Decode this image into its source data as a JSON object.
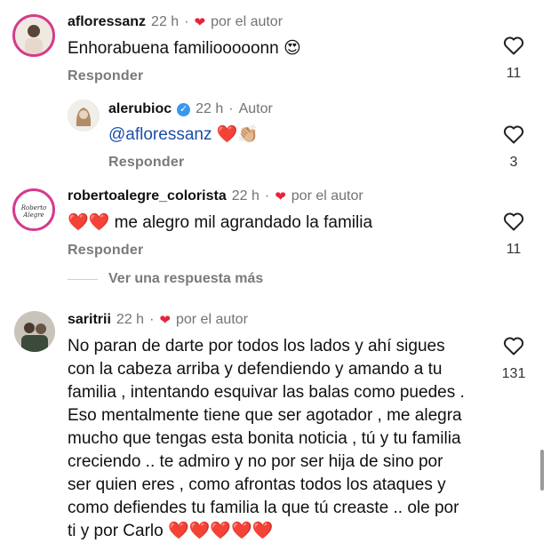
{
  "comments": [
    {
      "username": "afloressanz",
      "time": "22 h",
      "liked_by_author": "por el autor",
      "text": "Enhorabuena familiooooonn",
      "text_emoji": "😍",
      "reply_label": "Responder",
      "likes": "11"
    },
    {
      "username": "alerubioc",
      "time": "22 h",
      "author_tag": "Autor",
      "mention": "@afloressanz",
      "text_emoji": "❤️👏🏼",
      "reply_label": "Responder",
      "likes": "3"
    },
    {
      "username": "robertoalegre_colorista",
      "time": "22 h",
      "liked_by_author": "por el autor",
      "text_emoji": "❤️❤️",
      "text": "me alegro mil agrandado la familia",
      "reply_label": "Responder",
      "likes": "11",
      "avatar_text": "Roberto Alegre",
      "more_replies": "Ver una respuesta más"
    },
    {
      "username": "saritrii",
      "time": "22 h",
      "liked_by_author": "por el autor",
      "text": "No paran de darte por todos los lados y ahí sigues con la cabeza arriba y defendiendo y amando a tu familia , intentando esquivar las balas como puedes . Eso mentalmente tiene que ser agotador , me alegra mucho que tengas esta bonita noticia , tú y tu familia creciendo .. te admiro y no por ser hija de sino por ser quien eres , como afrontas todos los ataques y como defiendes tu familia la que tú creaste .. ole por ti y por Carlo",
      "text_emoji": "❤️❤️❤️❤️❤️",
      "likes": "131"
    }
  ],
  "colors": {
    "heart_red": "#e8233c",
    "muted_gray": "#737373",
    "mention_blue": "#1a4fa8",
    "verified_blue": "#3897f0"
  }
}
